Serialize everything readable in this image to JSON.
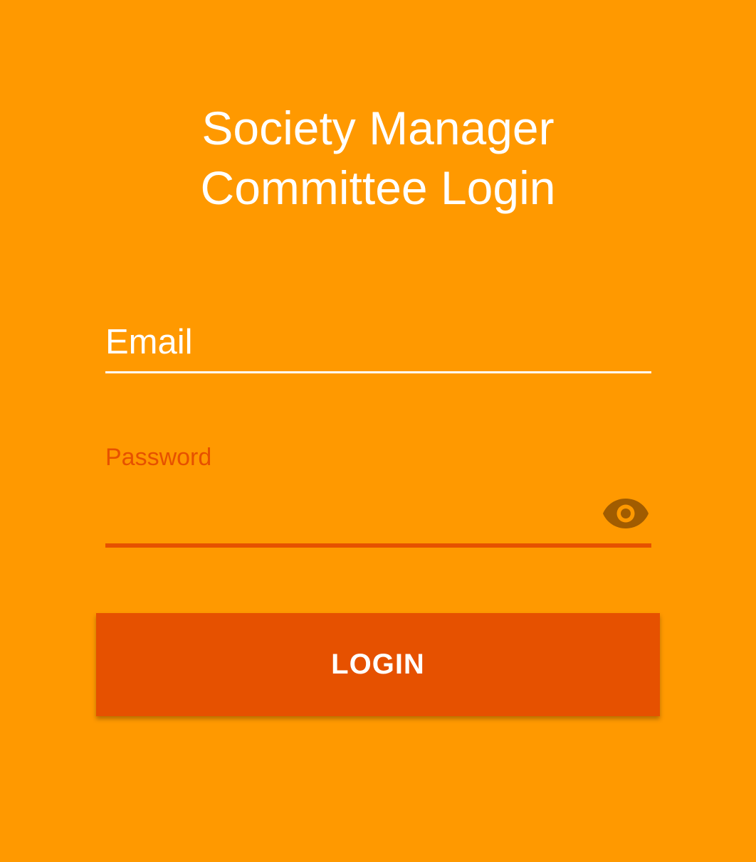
{
  "colors": {
    "background": "#ff9900",
    "text_white": "#ffffff",
    "accent": "#e65100",
    "eye_icon": "#a15c00"
  },
  "header": {
    "title_line1": "Society Manager",
    "title_line2": "Committee Login"
  },
  "form": {
    "email": {
      "placeholder": "Email",
      "value": ""
    },
    "password": {
      "label": "Password",
      "value": "",
      "toggle_icon": "eye-icon"
    },
    "login_button_label": "LOGIN"
  }
}
